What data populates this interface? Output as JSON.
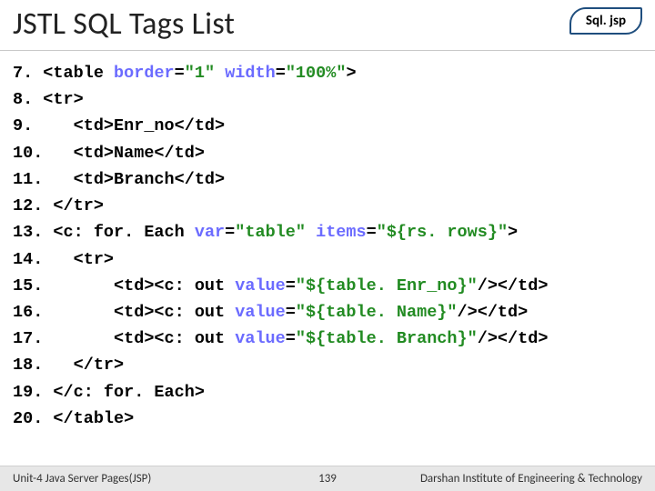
{
  "header": {
    "title": "JSTL SQL Tags List",
    "filename": "Sql. jsp"
  },
  "code_lines": [
    [
      {
        "t": "7. <table "
      },
      {
        "t": "border",
        "c": "attr"
      },
      {
        "t": "="
      },
      {
        "t": "\"1\"",
        "c": "val"
      },
      {
        "t": " "
      },
      {
        "t": "width",
        "c": "attr"
      },
      {
        "t": "="
      },
      {
        "t": "\"100%\"",
        "c": "val"
      },
      {
        "t": ">"
      }
    ],
    [
      {
        "t": "8. <tr>"
      }
    ],
    [
      {
        "t": "9.    <td>Enr_no</td>"
      }
    ],
    [
      {
        "t": "10.   <td>Name</td>"
      }
    ],
    [
      {
        "t": "11.   <td>Branch</td>"
      }
    ],
    [
      {
        "t": "12. </tr>"
      }
    ],
    [
      {
        "t": "13. <c: for. Each "
      },
      {
        "t": "var",
        "c": "attr"
      },
      {
        "t": "="
      },
      {
        "t": "\"table\"",
        "c": "val"
      },
      {
        "t": " "
      },
      {
        "t": "items",
        "c": "attr"
      },
      {
        "t": "="
      },
      {
        "t": "\"${rs. rows}\"",
        "c": "val"
      },
      {
        "t": ">"
      }
    ],
    [
      {
        "t": "14.   <tr>"
      }
    ],
    [
      {
        "t": "15.       <td><c: out "
      },
      {
        "t": "value",
        "c": "attr"
      },
      {
        "t": "="
      },
      {
        "t": "\"${table. Enr_no}\"",
        "c": "val"
      },
      {
        "t": "/></td>"
      }
    ],
    [
      {
        "t": "16.       <td><c: out "
      },
      {
        "t": "value",
        "c": "attr"
      },
      {
        "t": "="
      },
      {
        "t": "\"${table. Name}\"",
        "c": "val"
      },
      {
        "t": "/></td>"
      }
    ],
    [
      {
        "t": "17.       <td><c: out "
      },
      {
        "t": "value",
        "c": "attr"
      },
      {
        "t": "="
      },
      {
        "t": "\"${table. Branch}\"",
        "c": "val"
      },
      {
        "t": "/></td>"
      }
    ],
    [
      {
        "t": "18.   </tr>"
      }
    ],
    [
      {
        "t": "19. </c: for. Each>"
      }
    ],
    [
      {
        "t": "20. </table>"
      }
    ]
  ],
  "footer": {
    "left": "Unit-4 Java Server Pages(JSP)",
    "page": "139",
    "right": "Darshan Institute of Engineering & Technology"
  }
}
